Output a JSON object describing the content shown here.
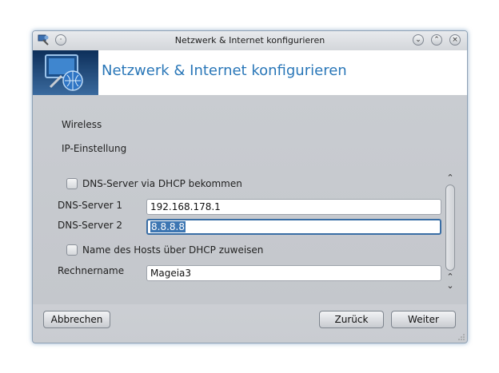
{
  "window": {
    "title": "Netzwerk & Internet konfigurieren"
  },
  "banner": {
    "title": "Netzwerk & Internet konfigurieren"
  },
  "steps": {
    "wireless": "Wireless",
    "ip": "IP-Einstellung"
  },
  "form": {
    "dns_dhcp_label": "DNS-Server via DHCP bekommen",
    "dns1_label": "DNS-Server 1",
    "dns1_value": "192.168.178.1",
    "dns2_label": "DNS-Server 2",
    "dns2_value": "8.8.8.8",
    "hostname_dhcp_label": "Name des Hosts über DHCP zuweisen",
    "hostname_label": "Rechnername",
    "hostname_value": "Mageia3"
  },
  "buttons": {
    "cancel": "Abbrechen",
    "back": "Zurück",
    "next": "Weiter"
  },
  "colors": {
    "accent": "#2a77b8",
    "selection": "#3d76b2"
  }
}
